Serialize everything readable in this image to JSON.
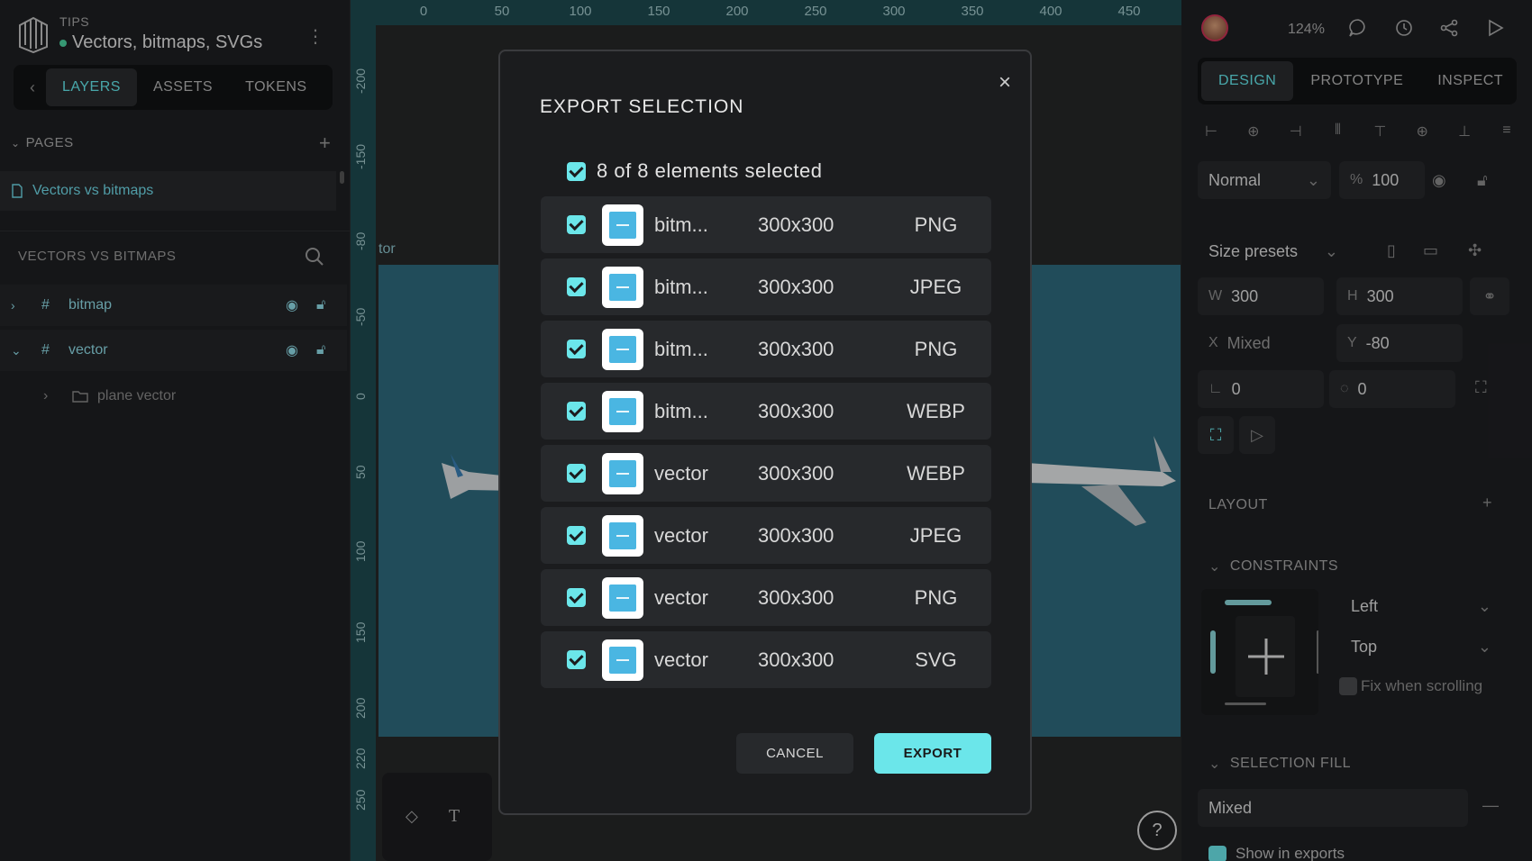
{
  "sidebar": {
    "tips_label": "TIPS",
    "file_title": "Vectors, bitmaps, SVGs",
    "tabs": [
      "LAYERS",
      "ASSETS",
      "TOKENS"
    ],
    "pages_header": "PAGES",
    "page_name": "Vectors vs bitmaps",
    "layers_header": "VECTORS VS BITMAPS",
    "layers": [
      {
        "name": "bitmap"
      },
      {
        "name": "vector"
      }
    ],
    "sub_layer": "plane vector"
  },
  "canvas": {
    "ruler_top": [
      "0",
      "50",
      "100",
      "150",
      "200",
      "250",
      "300",
      "350",
      "400",
      "450"
    ],
    "ruler_left": [
      "-200",
      "-150",
      "-80",
      "-50",
      "0",
      "50",
      "100",
      "150",
      "200",
      "220",
      "250"
    ],
    "artboard_label": "tor",
    "tool_icons": [
      "droplet-icon",
      "text-icon"
    ],
    "help_label": "?"
  },
  "right_panel": {
    "zoom": "124%",
    "tabs": [
      "DESIGN",
      "PROTOTYPE",
      "INSPECT"
    ],
    "blend_mode": "Normal",
    "opacity_label": "%",
    "opacity_value": "100",
    "size_presets": "Size presets",
    "w_label": "W",
    "w_value": "300",
    "h_label": "H",
    "h_value": "300",
    "x_label": "X",
    "x_value": "Mixed",
    "y_label": "Y",
    "y_value": "-80",
    "rotation_value": "0",
    "radius_value": "0",
    "layout_header": "LAYOUT",
    "constraints_header": "CONSTRAINTS",
    "constraint_h": "Left",
    "constraint_v": "Top",
    "fix_scrolling": "Fix when scrolling",
    "selection_fill_header": "SELECTION FILL",
    "fill_value": "Mixed",
    "show_in_exports": "Show in exports"
  },
  "modal": {
    "title": "EXPORT SELECTION",
    "summary": "8 of 8 elements selected",
    "rows": [
      {
        "name": "bitm...",
        "size": "300x300",
        "format": "PNG"
      },
      {
        "name": "bitm...",
        "size": "300x300",
        "format": "JPEG"
      },
      {
        "name": "bitm...",
        "size": "300x300",
        "format": "PNG"
      },
      {
        "name": "bitm...",
        "size": "300x300",
        "format": "WEBP"
      },
      {
        "name": "vector",
        "size": "300x300",
        "format": "WEBP"
      },
      {
        "name": "vector",
        "size": "300x300",
        "format": "JPEG"
      },
      {
        "name": "vector",
        "size": "300x300",
        "format": "PNG"
      },
      {
        "name": "vector",
        "size": "300x300",
        "format": "SVG"
      }
    ],
    "cancel_label": "CANCEL",
    "export_label": "EXPORT"
  },
  "colors": {
    "accent": "#6be6ea",
    "background": "#18191b",
    "panel": "#1e1f22",
    "artboard": "#2f6a7d"
  }
}
